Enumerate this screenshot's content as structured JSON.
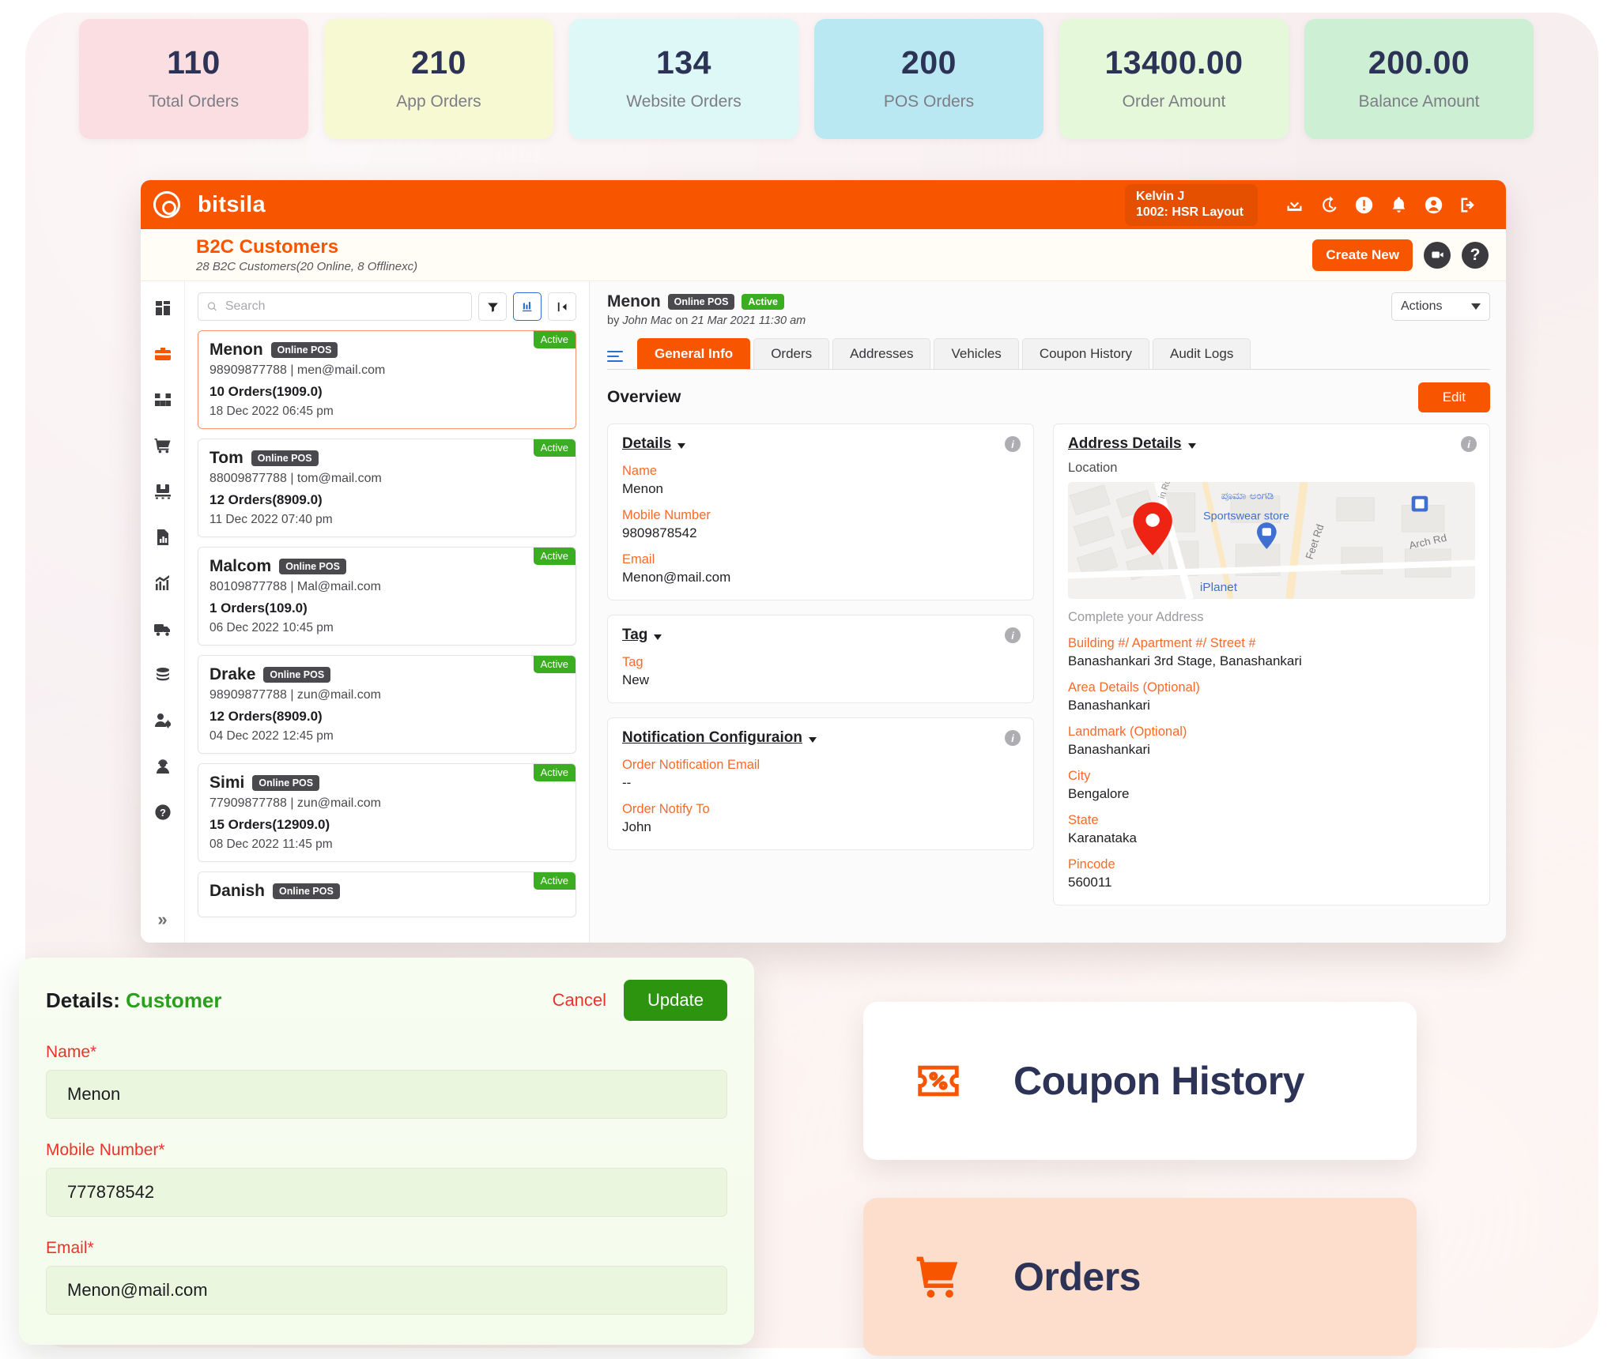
{
  "kpis": [
    {
      "value": "110",
      "label": "Total Orders",
      "bg": "#fbdee1"
    },
    {
      "value": "210",
      "label": "App Orders",
      "bg": "#f6f9d2"
    },
    {
      "value": "134",
      "label": "Website Orders",
      "bg": "#ddf8f6"
    },
    {
      "value": "200",
      "label": "POS Orders",
      "bg": "#b9e8f2"
    },
    {
      "value": "13400.00",
      "label": "Order Amount",
      "bg": "#e5f8d9"
    },
    {
      "value": "200.00",
      "label": "Balance Amount",
      "bg": "#cdf0d4"
    }
  ],
  "topbar": {
    "brand": "bitsila",
    "user_name": "Kelvin J",
    "user_store": "1002: HSR Layout",
    "icons": [
      "download-icon",
      "history-icon",
      "alert-icon",
      "bell-icon",
      "account-icon",
      "logout-icon"
    ]
  },
  "pagehead": {
    "title": "B2C Customers",
    "subtitle": "28 B2C Customers(20 Online, 8 Offlinexc)",
    "create_label": "Create New",
    "help_label": "?"
  },
  "rail": {
    "items": [
      {
        "name": "dashboard-icon",
        "active": false
      },
      {
        "name": "briefcase-icon",
        "active": true
      },
      {
        "name": "boxes-icon",
        "active": false
      },
      {
        "name": "cart-icon",
        "active": false
      },
      {
        "name": "inventory-icon",
        "active": false
      },
      {
        "name": "report-icon",
        "active": false
      },
      {
        "name": "analytics-icon",
        "active": false
      },
      {
        "name": "truck-icon",
        "active": false
      },
      {
        "name": "coins-icon",
        "active": false
      },
      {
        "name": "user-settings-icon",
        "active": false
      },
      {
        "name": "agent-icon",
        "active": false
      },
      {
        "name": "help-icon",
        "active": false
      }
    ],
    "collapse_label": "»"
  },
  "list": {
    "search_placeholder": "Search",
    "filter_icon": "filter-icon",
    "sort_icon": "sort-bars-icon",
    "collapse_icon": "collapse-panel-icon",
    "customers": [
      {
        "name": "Menon",
        "channel": "Online POS",
        "status": "Active",
        "contact": "98909877788 | men@mail.com",
        "orders": "10 Orders(1909.0)",
        "date": "18 Dec 2022 06:45 pm",
        "selected": true
      },
      {
        "name": "Tom",
        "channel": "Online POS",
        "status": "Active",
        "contact": "88009877788 | tom@mail.com",
        "orders": "12 Orders(8909.0)",
        "date": "11 Dec 2022 07:40 pm",
        "selected": false
      },
      {
        "name": "Malcom",
        "channel": "Online POS",
        "status": "Active",
        "contact": "80109877788 | Mal@mail.com",
        "orders": "1 Orders(109.0)",
        "date": "06 Dec 2022 10:45 pm",
        "selected": false
      },
      {
        "name": "Drake",
        "channel": "Online POS",
        "status": "Active",
        "contact": "98909877788 | zun@mail.com",
        "orders": "12 Orders(8909.0)",
        "date": "04 Dec 2022 12:45 pm",
        "selected": false
      },
      {
        "name": "Simi",
        "channel": "Online POS",
        "status": "Active",
        "contact": "77909877788 | zun@mail.com",
        "orders": "15 Orders(12909.0)",
        "date": "08 Dec 2022 11:45 pm",
        "selected": false
      },
      {
        "name": "Danish",
        "channel": "Online POS",
        "status": "Active",
        "contact": "",
        "orders": "",
        "date": "",
        "selected": false
      }
    ]
  },
  "detail": {
    "name": "Menon",
    "channel": "Online POS",
    "status": "Active",
    "byline_prefix": "by ",
    "byline_author": "John Mac",
    "byline_mid": " on ",
    "byline_date": "21 Mar 2021 11:30 am",
    "actions_label": "Actions",
    "tabs": [
      {
        "label": "General Info",
        "active": true
      },
      {
        "label": "Orders",
        "active": false
      },
      {
        "label": "Addresses",
        "active": false
      },
      {
        "label": "Vehicles",
        "active": false
      },
      {
        "label": "Coupon History",
        "active": false
      },
      {
        "label": "Audit Logs",
        "active": false
      }
    ],
    "overview_title": "Overview",
    "edit_label": "Edit",
    "details_card": {
      "title": "Details",
      "fields": [
        {
          "label": "Name",
          "value": "Menon"
        },
        {
          "label": "Mobile Number",
          "value": "9809878542"
        },
        {
          "label": "Email",
          "value": "Menon@mail.com"
        }
      ]
    },
    "tag_card": {
      "title": "Tag",
      "fields": [
        {
          "label": "Tag",
          "value": "New"
        }
      ]
    },
    "notification_card": {
      "title": "Notification Configuraion",
      "fields": [
        {
          "label": "Order Notification Email",
          "value": "--"
        },
        {
          "label": "Order Notify To",
          "value": "John"
        }
      ]
    },
    "address_card": {
      "title": "Address Details",
      "location_label": "Location",
      "map_labels": [
        "ಪೂಮಾ ಅಂಗಡಿ",
        "Sportswear store",
        "iPlanet",
        "Feet Rd",
        "Arch Rd"
      ],
      "complete_label": "Complete your Address",
      "fields": [
        {
          "label": "Building #/ Apartment #/ Street #",
          "value": "Banashankari 3rd Stage, Banashankari"
        },
        {
          "label": "Area Details (Optional)",
          "value": "Banashankari"
        },
        {
          "label": "Landmark (Optional)",
          "value": "Banashankari"
        },
        {
          "label": "City",
          "value": "Bengalore"
        },
        {
          "label": "State",
          "value": "Karanataka"
        },
        {
          "label": "Pincode",
          "value": "560011"
        }
      ]
    }
  },
  "form": {
    "title_static": "Details: ",
    "title_accent": "Customer",
    "cancel_label": "Cancel",
    "update_label": "Update",
    "fields": [
      {
        "label": "Name",
        "required": "*",
        "value": "Menon"
      },
      {
        "label": "Mobile Number",
        "required": "*",
        "value": "777878542"
      },
      {
        "label": "Email",
        "required": "*",
        "value": "Menon@mail.com"
      }
    ]
  },
  "features": [
    {
      "label": "Coupon History",
      "icon": "coupon-icon"
    },
    {
      "label": "Orders",
      "icon": "cart-icon"
    }
  ],
  "colors": {
    "brand_orange": "#f75500",
    "accent_orange": "#f96a28",
    "green": "#3aad20",
    "update_green": "#2d9410",
    "navy": "#2c3356",
    "red": "#e8342a"
  }
}
